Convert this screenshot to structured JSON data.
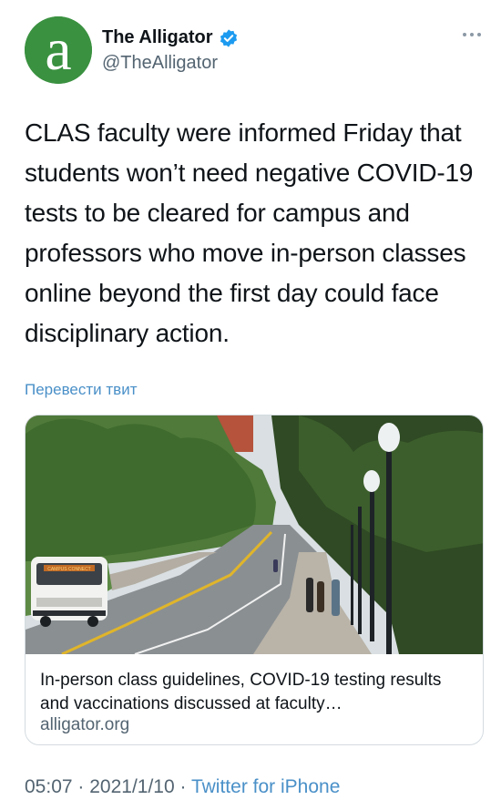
{
  "account": {
    "display_name": "The Alligator",
    "handle": "@TheAlligator",
    "avatar_letter": "a",
    "avatar_color": "#3a9140",
    "verified_color": "#1d9bf0"
  },
  "tweet": {
    "text": "CLAS faculty were informed Friday that students won’t need negative COVID-19 tests to be cleared for campus and professors who move in-person classes online beyond the first day could face disciplinary action.",
    "translate_label": "Перевести твит"
  },
  "card": {
    "title": "In-person class guidelines, COVID-19 testing results and vaccinations discussed at faculty…",
    "domain": "alligator.org",
    "image_icon": "campus-street-photo",
    "bus_sign": "CAMPUS CONNECT"
  },
  "meta": {
    "time": "05:07",
    "separator1": " · ",
    "date": "2021/1/10",
    "separator2": " · ",
    "source": "Twitter for iPhone"
  },
  "colors": {
    "accent_link": "#4a90c8",
    "secondary_text": "#536471",
    "primary_text": "#0f1419"
  }
}
